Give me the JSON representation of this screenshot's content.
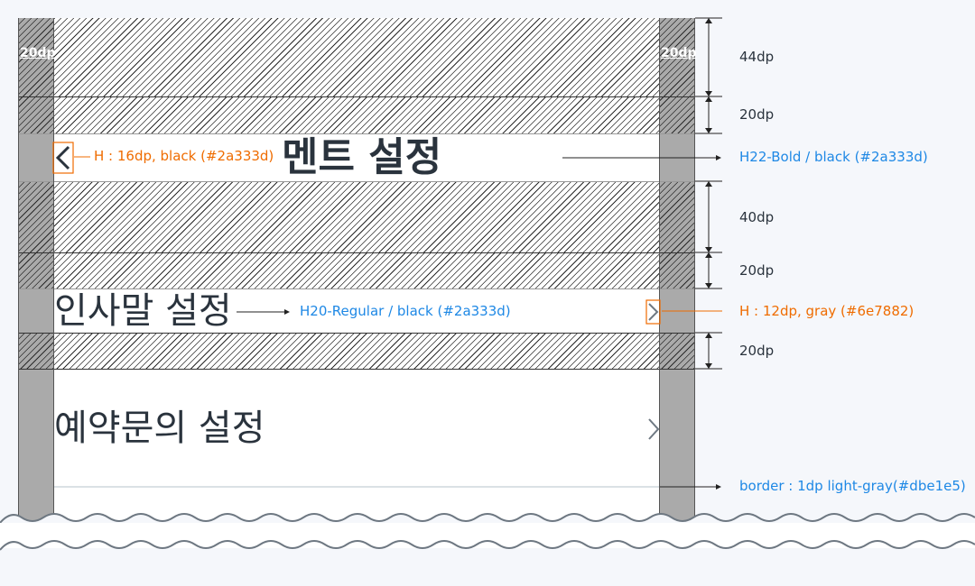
{
  "screen": {
    "title": "멘트 설정",
    "rows": [
      {
        "label": "인사말 설정"
      },
      {
        "label": "예약문의 설정"
      }
    ]
  },
  "annotations": {
    "gutter_left": "20dp",
    "gutter_right": "20dp",
    "spacing": [
      "44dp",
      "20dp",
      "40dp",
      "20dp",
      "20dp"
    ],
    "back_icon": "H : 16dp, black (#2a333d)",
    "title_style": "H22-Bold / black (#2a333d)",
    "row_style": "H20-Regular / black (#2a333d)",
    "chevron": "H : 12dp, gray (#6e7882)",
    "border": "border : 1dp light-gray(#dbe1e5)"
  },
  "colors": {
    "annotation_blue": "#1e88e5",
    "annotation_orange": "#ef6c00",
    "text_black": "#2a333d",
    "chevron_gray": "#6e7882",
    "border_light_gray": "#dbe1e5",
    "gutter_gray": "#aaaaaa"
  },
  "icons": [
    "back-chevron-icon",
    "chevron-right-icon",
    "wave-break-icon"
  ]
}
